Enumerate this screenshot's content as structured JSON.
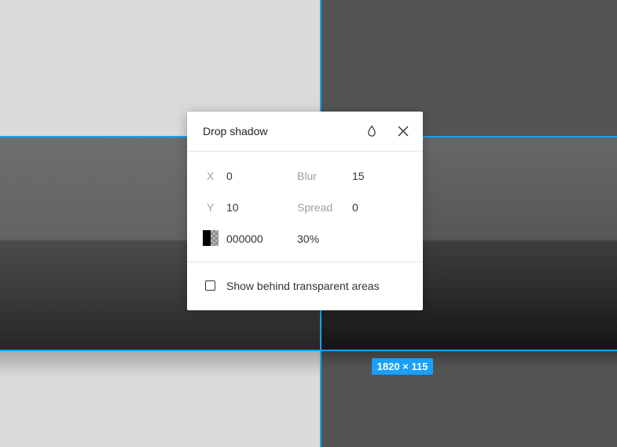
{
  "panel": {
    "title": "Drop shadow",
    "fields": {
      "x_label": "X",
      "x_value": "0",
      "y_label": "Y",
      "y_value": "10",
      "blur_label": "Blur",
      "blur_value": "15",
      "spread_label": "Spread",
      "spread_value": "0",
      "color_value": "000000",
      "opacity_value": "30%"
    },
    "show_behind_label": "Show behind transparent areas",
    "show_behind_checked": false,
    "icons": {
      "style": "drop-icon",
      "close": "close-icon"
    }
  },
  "canvas": {
    "size_badge": "1820 × 115",
    "colors": {
      "guide": "#18a0fb",
      "shadow": "#000000"
    }
  }
}
